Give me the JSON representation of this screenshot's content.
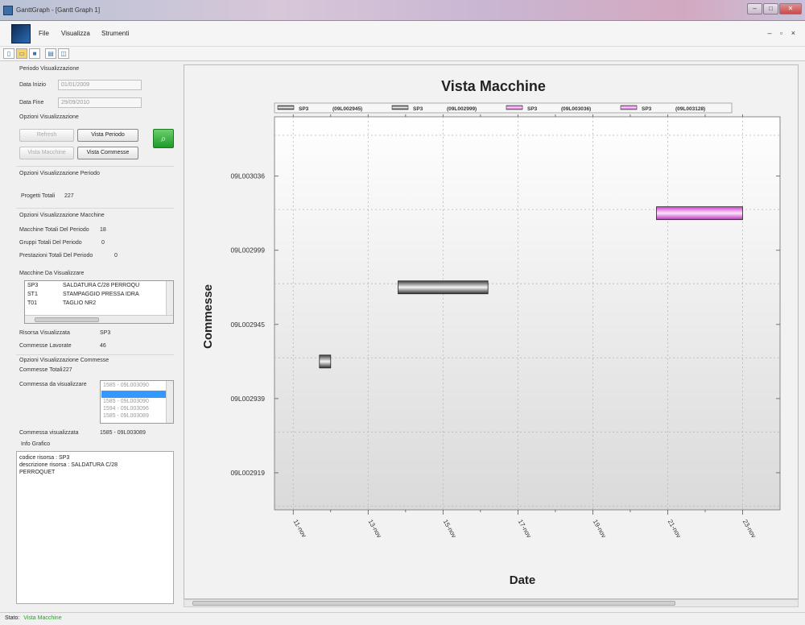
{
  "window": {
    "title": "GanttGraph - [Gantt Graph 1]"
  },
  "menu": {
    "items": [
      "File",
      "Visualizza",
      "Strumenti"
    ]
  },
  "left": {
    "periodo_title": "Periodo Visualizzazione",
    "data_inizio_label": "Data Inizio",
    "data_inizio_value": "01/01/2009",
    "data_fine_label": "Data Fine",
    "data_fine_value": "29/09/2010",
    "opzioni_title": "Opzioni Visualizzazione",
    "refresh_label": "Refresh",
    "vista_periodo_label": "Vista Periodo",
    "vista_macchine_label": "Vista Macchine",
    "vista_commesse_label": "Vista Commesse",
    "opz_periodo_title": "Opzioni Visualizzazione Periodo",
    "progetti_totali_label": "Progetti Totali",
    "progetti_totali_value": "227",
    "opz_macchine_title": "Opzioni Visualizzazione Macchine",
    "macchine_totali_label": "Macchine Totali Del Periodo",
    "macchine_totali_value": "18",
    "gruppi_totali_label": "Gruppi Totali Del Periodo",
    "gruppi_totali_value": "0",
    "prestazioni_totali_label": "Prestazioni Totali Del Periodo",
    "prestazioni_totali_value": "0",
    "macchine_da_vis_label": "Macchine Da Visualizzare",
    "machines": [
      {
        "code": "SP3",
        "desc": "SALDATURA C/28 PERROQU"
      },
      {
        "code": "ST1",
        "desc": "STAMPAGGIO PRESSA IDRA"
      },
      {
        "code": "T01",
        "desc": "TAGLIO NR2"
      }
    ],
    "risorsa_label": "Risorsa Visualizzata",
    "risorsa_value": "SP3",
    "commesse_lavorate_label": "Commesse Lavorate",
    "commesse_lavorate_value": "46",
    "opz_commesse_title": "Opzioni Visualizzazione Commesse",
    "commesse_totali_label": "Commesse Totali",
    "commesse_totali_value": "227",
    "commessa_da_vis_label": "Commessa da visualizzare",
    "commesse_list": [
      "1585 - 09L003090",
      "",
      "1585 - 09L003090",
      "1594 - 09L003096",
      "1585 - 09L003089"
    ],
    "commessa_visualizzata_label": "Commessa visualizzata",
    "commessa_visualizzata_value": "1585 - 09L003089",
    "info_title": "Info Grafico",
    "info_line1": "codice risorsa : SP3",
    "info_line2": "descrizione risorsa : SALDATURA C/28",
    "info_line3": "PERROQUET"
  },
  "status": {
    "label": "Stato:",
    "value": "Vista Macchine"
  },
  "chart_data": {
    "type": "gantt",
    "title": "Vista Macchine",
    "xlabel": "Date",
    "ylabel": "Commesse",
    "legend": [
      {
        "name": "SP3",
        "id": "(09L002945)",
        "color": "#606060"
      },
      {
        "name": "SP3",
        "id": "(09L002999)",
        "color": "#606060"
      },
      {
        "name": "SP3",
        "id": "(09L003036)",
        "color": "#e070e0"
      },
      {
        "name": "SP3",
        "id": "(09L003128)",
        "color": "#e070e0"
      }
    ],
    "categories": [
      "09L002919",
      "09L002939",
      "09L002945",
      "09L002999",
      "09L003036"
    ],
    "x_ticks": [
      "11-nov",
      "13-nov",
      "15-nov",
      "17-nov",
      "19-nov",
      "21-nov",
      "23-nov"
    ],
    "x_range_days": [
      10.5,
      24
    ],
    "bars": [
      {
        "category": "09L002945",
        "start": 11.7,
        "end": 12.0,
        "color": "#505050"
      },
      {
        "category": "09L002999",
        "start": 13.8,
        "end": 16.2,
        "color": "#505050"
      },
      {
        "category": "09L003036",
        "start": 20.7,
        "end": 23.0,
        "color": "#e070e0"
      }
    ],
    "grid": true,
    "legend_position": "top"
  }
}
